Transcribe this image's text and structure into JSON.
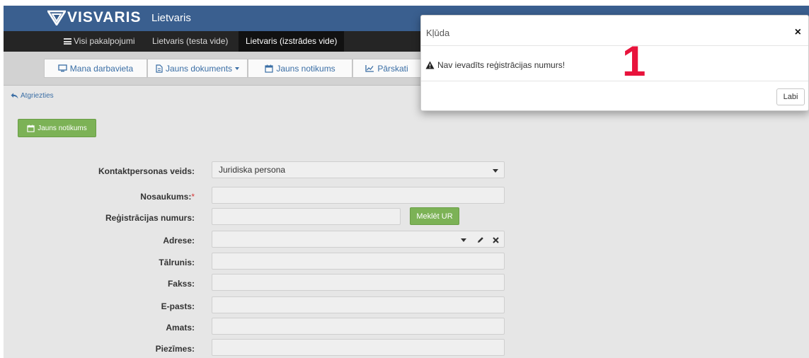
{
  "header": {
    "logo_text": "VISVARIS",
    "app_title": "Lietvaris"
  },
  "nav": {
    "items": [
      {
        "label": "Visi pakalpojumi"
      },
      {
        "label": "Lietvaris (testa vide)"
      },
      {
        "label": "Lietvaris (izstrādes vide)"
      }
    ]
  },
  "toolbar": {
    "workplace": "Mana darbavieta",
    "new_document": "Jauns dokuments",
    "new_event": "Jauns notikums",
    "reports": "Pārskati"
  },
  "back_link": "Atgriezties",
  "new_event_button": "Jauns notikums",
  "form": {
    "contact_type": {
      "label": "Kontaktpersonas veids:",
      "value": "Juridiska persona"
    },
    "name": {
      "label": "Nosaukums:",
      "required_mark": "*",
      "value": ""
    },
    "reg_number": {
      "label": "Reģistrācijas numurs:",
      "value": "",
      "search_button": "Meklēt UR"
    },
    "address": {
      "label": "Adrese:",
      "value": ""
    },
    "phone": {
      "label": "Tālrunis:",
      "value": ""
    },
    "fax": {
      "label": "Fakss:",
      "value": ""
    },
    "email": {
      "label": "E-pasts:",
      "value": ""
    },
    "position": {
      "label": "Amats:",
      "value": ""
    },
    "notes": {
      "label": "Piezīmes:",
      "value": ""
    }
  },
  "dialog": {
    "title": "Kļūda",
    "message": "Nav ievadīts reģistrācijas numurs!",
    "annotation": "1",
    "ok_button": "Labi",
    "close_symbol": "×"
  },
  "colors": {
    "header": "#3a5f8f",
    "navbar": "#252525",
    "green_button": "#7cb256",
    "link": "#3a6ea5",
    "annotation": "#e8133c"
  }
}
